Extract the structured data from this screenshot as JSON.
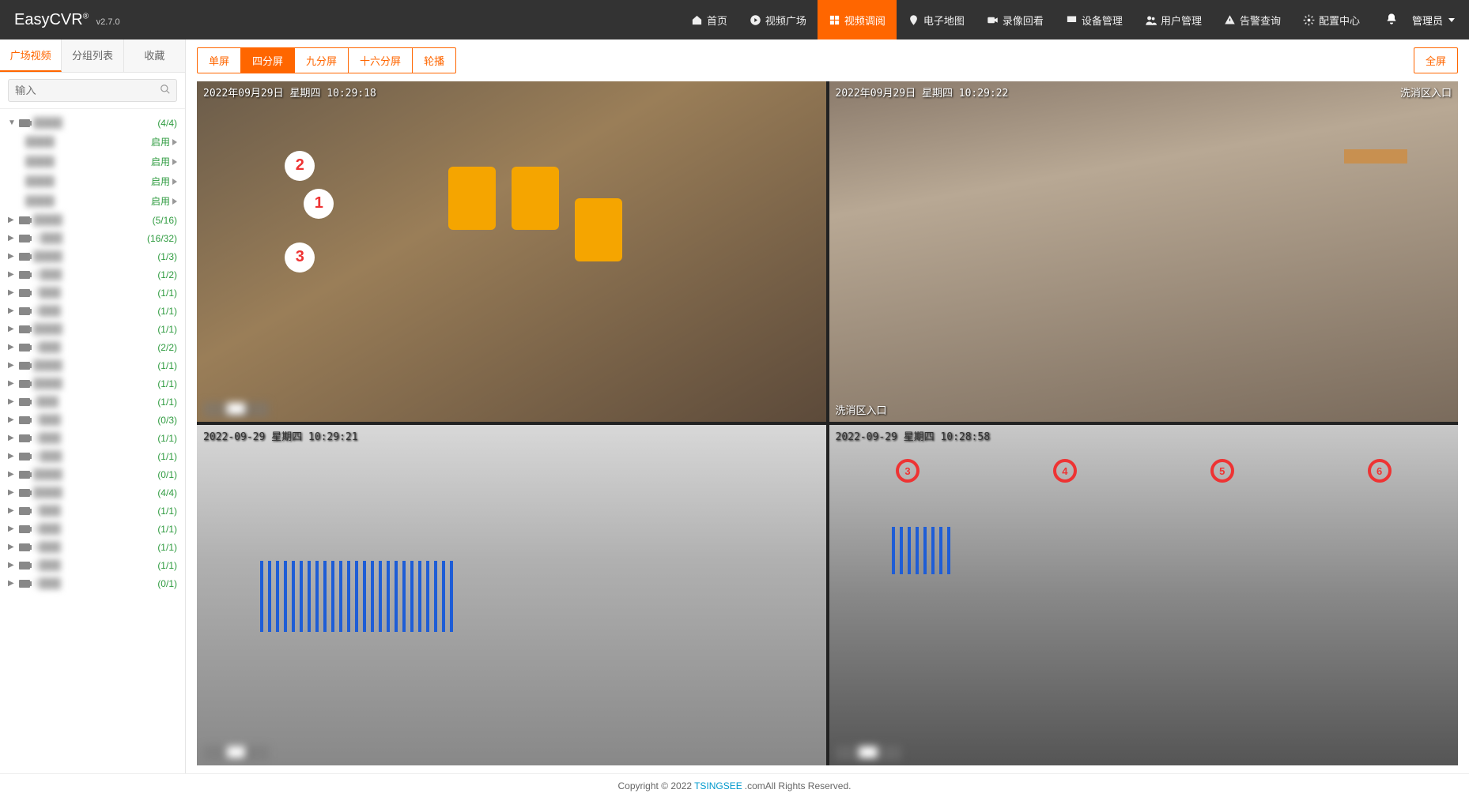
{
  "brand": {
    "name": "EasyCVR",
    "reg": "®",
    "version": "v2.7.0"
  },
  "nav": {
    "items": [
      {
        "label": "首页",
        "icon": "home"
      },
      {
        "label": "视频广场",
        "icon": "play"
      },
      {
        "label": "视频调阅",
        "icon": "grid",
        "active": true
      },
      {
        "label": "电子地图",
        "icon": "map"
      },
      {
        "label": "录像回看",
        "icon": "cam"
      },
      {
        "label": "设备管理",
        "icon": "device"
      },
      {
        "label": "用户管理",
        "icon": "user"
      },
      {
        "label": "告警查询",
        "icon": "alert"
      },
      {
        "label": "配置中心",
        "icon": "gear"
      }
    ],
    "admin": "管理员"
  },
  "sidebar": {
    "tabs": [
      "广场视频",
      "分组列表",
      "收藏"
    ],
    "activeTab": 0,
    "searchPlaceholder": "输入",
    "tree": [
      {
        "type": "group",
        "label": "████",
        "count": "(4/4)",
        "expanded": true,
        "children": [
          {
            "label": "████",
            "status": "启用"
          },
          {
            "label": "████",
            "status": "启用"
          },
          {
            "label": "████",
            "status": "启用"
          },
          {
            "label": "████",
            "status": "启用"
          }
        ]
      },
      {
        "type": "group",
        "label": "████",
        "count": "(5/16)"
      },
      {
        "type": "device",
        "label": "C███",
        "count": "(16/32)"
      },
      {
        "type": "device",
        "label": "████",
        "count": "(1/3)"
      },
      {
        "type": "device",
        "label": "E███",
        "count": "(1/2)"
      },
      {
        "type": "device",
        "label": "7███",
        "count": "(1/1)"
      },
      {
        "type": "device",
        "label": "6███",
        "count": "(1/1)"
      },
      {
        "type": "device",
        "label": "████",
        "count": "(1/1)"
      },
      {
        "type": "device",
        "label": "3███",
        "count": "(2/2)"
      },
      {
        "type": "device",
        "label": "████",
        "count": "(1/1)"
      },
      {
        "type": "device",
        "label": "████",
        "count": "(1/1)"
      },
      {
        "type": "device",
        "label": "r███",
        "count": "(1/1)"
      },
      {
        "type": "device",
        "label": "7███",
        "count": "(0/3)"
      },
      {
        "type": "device",
        "label": "2███",
        "count": "(1/1)"
      },
      {
        "type": "device",
        "label": "E███",
        "count": "(1/1)"
      },
      {
        "type": "device",
        "label": "████",
        "count": "(0/1)"
      },
      {
        "type": "device",
        "label": "████",
        "count": "(4/4)"
      },
      {
        "type": "device",
        "label": "7███",
        "count": "(1/1)"
      },
      {
        "type": "device",
        "label": "6███",
        "count": "(1/1)"
      },
      {
        "type": "device",
        "label": "4███",
        "count": "(1/1)"
      },
      {
        "type": "device",
        "label": "1███",
        "count": "(1/1)"
      },
      {
        "type": "device",
        "label": "5███",
        "count": "(0/1)"
      }
    ]
  },
  "toolbar": {
    "layouts": [
      "单屏",
      "四分屏",
      "九分屏",
      "十六分屏",
      "轮播"
    ],
    "activeLayout": 1,
    "fullscreen": "全屏"
  },
  "feeds": [
    {
      "osd_tl": "2022年09月29日 星期四 10:29:18",
      "osd_tr": "",
      "osd_bl": "███"
    },
    {
      "osd_tl": "2022年09月29日 星期四 10:29:22",
      "osd_tr": "洗消区入口",
      "osd_bl": "洗消区入口"
    },
    {
      "osd_tl": "2022-09-29 星期四 10:29:21",
      "osd_tr": "",
      "osd_bl": "███"
    },
    {
      "osd_tl": "2022-09-29 星期四 10:28:58",
      "osd_tr": "",
      "osd_bl": "███"
    }
  ],
  "footer": {
    "copyright": "Copyright © 2022 ",
    "brand": "TSINGSEE",
    "domain": ".com",
    "rights": " All Rights Reserved."
  }
}
